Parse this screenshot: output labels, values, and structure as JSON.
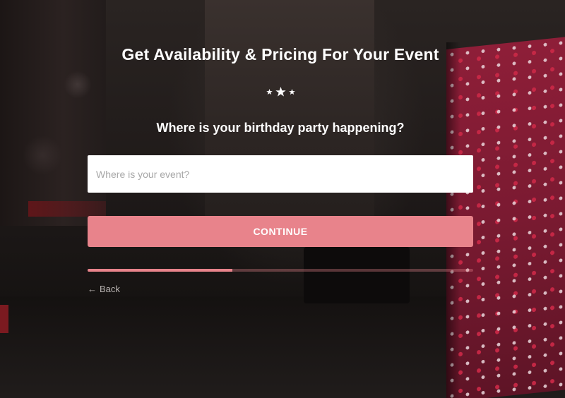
{
  "header": {
    "title": "Get Availability & Pricing For Your Event"
  },
  "decoration": {
    "stars_icon": "three-stars-icon",
    "star_color": "#ffffff"
  },
  "form": {
    "question": "Where is your birthday party happening?",
    "location_input": {
      "value": "",
      "placeholder": "Where is your event?"
    },
    "continue_label": "CONTINUE",
    "progress_fraction": 0.375,
    "back_label": "Back",
    "back_icon": "left-arrow-icon"
  },
  "colors": {
    "accent": "#e8838b",
    "text": "#ffffff"
  }
}
